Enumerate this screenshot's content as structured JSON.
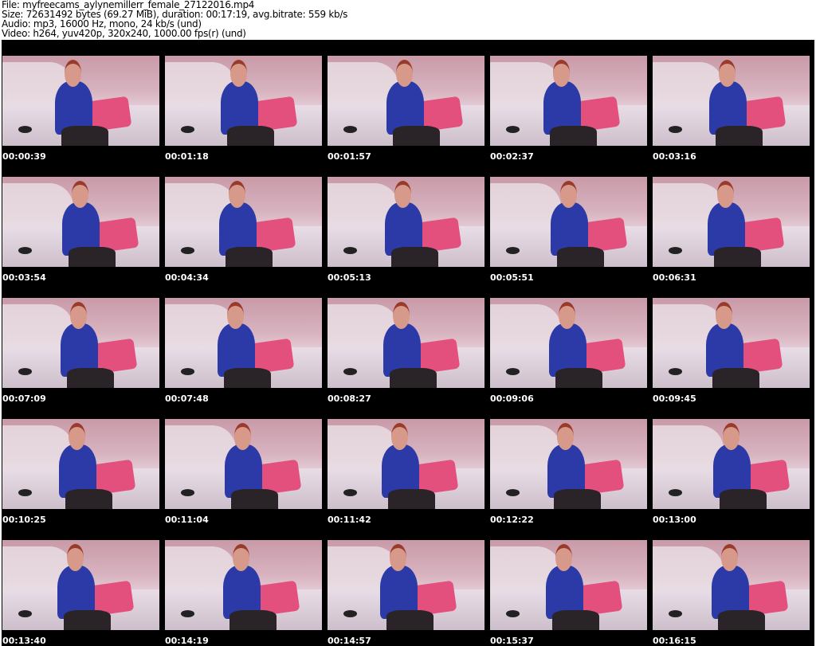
{
  "header": {
    "file": "File: myfreecams_aylynemillerr_female_27122016.mp4",
    "size": "Size: 72631492 bytes (69.27 MiB), duration: 00:17:19, avg.bitrate: 559 kb/s",
    "audio": "Audio: mp3, 16000 Hz, mono, 24 kb/s (und)",
    "video": "Video: h264, yuv420p, 320x240, 1000.00 fps(r) (und)"
  },
  "thumbnails": [
    "00:00:39",
    "00:01:18",
    "00:01:57",
    "00:02:37",
    "00:03:16",
    "00:03:54",
    "00:04:34",
    "00:05:13",
    "00:05:51",
    "00:06:31",
    "00:07:09",
    "00:07:48",
    "00:08:27",
    "00:09:06",
    "00:09:45",
    "00:10:25",
    "00:11:04",
    "00:11:42",
    "00:12:22",
    "00:13:00",
    "00:13:40",
    "00:14:19",
    "00:14:57",
    "00:15:37",
    "00:16:15"
  ]
}
